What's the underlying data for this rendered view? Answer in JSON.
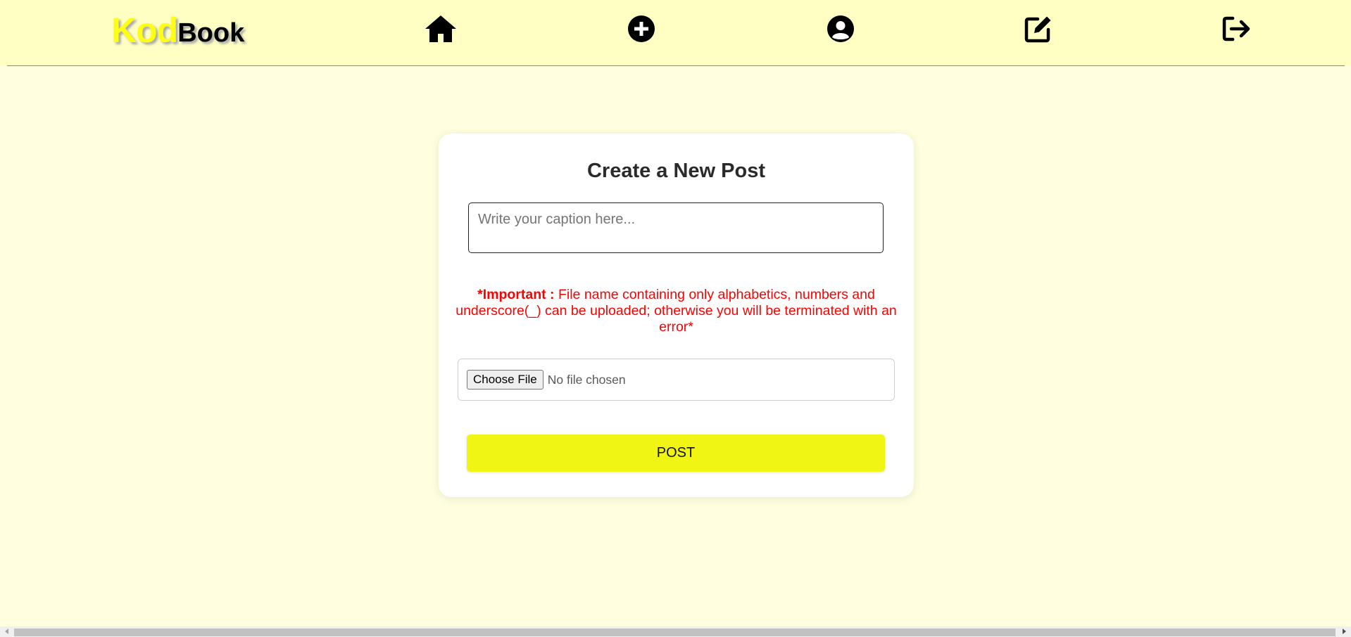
{
  "logo": {
    "part1": "Kod",
    "part2": "Book"
  },
  "nav": {
    "icons": [
      "home-icon",
      "add-post-icon",
      "profile-icon",
      "edit-icon",
      "logout-icon"
    ]
  },
  "form": {
    "title": "Create a New Post",
    "caption_placeholder": "Write your caption here...",
    "caption_value": "",
    "notice_label": "*Important :",
    "notice_text": " File name containing only alphabetics, numbers and underscore(_) can be uploaded; otherwise you will be terminated with an error*",
    "choose_file_label": "Choose File",
    "file_status": "No file chosen",
    "post_label": "POST"
  },
  "colors": {
    "page_background": "#ffffe0",
    "navbar_background": "#ffffc4",
    "logo_accent": "#ffff14",
    "notice_red": "#ff0000",
    "post_button": "#f0f514"
  }
}
